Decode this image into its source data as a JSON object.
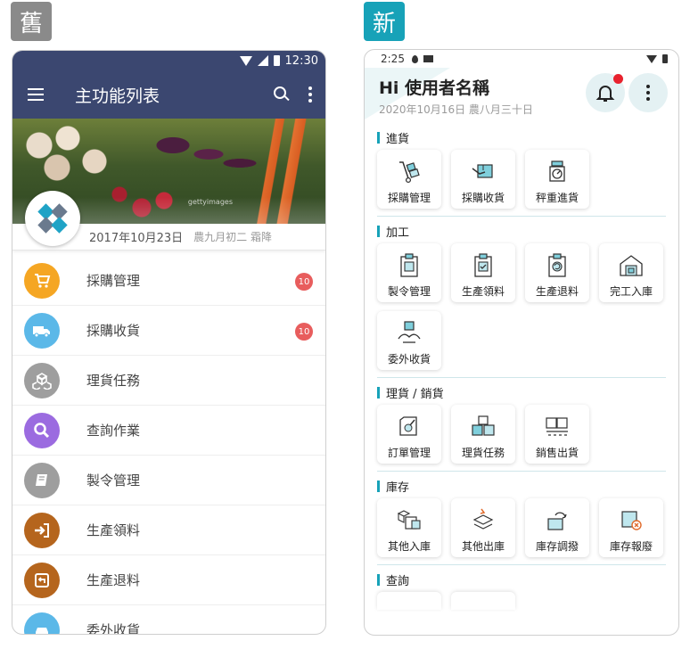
{
  "labels": {
    "old": "舊",
    "new": "新"
  },
  "old_app": {
    "status_time": "12:30",
    "title": "主功能列表",
    "banner_watermark": "gettyimages",
    "date": "2017年10月23日",
    "lunar": "農九月初二 霜降",
    "items": [
      {
        "label": "採購管理",
        "color": "#f5a623",
        "icon": "cart-icon",
        "badge": "10"
      },
      {
        "label": "採購收貨",
        "color": "#5bb8e8",
        "icon": "truck-icon",
        "badge": "10"
      },
      {
        "label": "理貨任務",
        "color": "#9e9e9e",
        "icon": "boxes-icon",
        "badge": ""
      },
      {
        "label": "查詢作業",
        "color": "#9b6be0",
        "icon": "search-icon",
        "badge": ""
      },
      {
        "label": "製令管理",
        "color": "#9e9e9e",
        "icon": "book-icon",
        "badge": ""
      },
      {
        "label": "生產領料",
        "color": "#b5651d",
        "icon": "sign-in-icon",
        "badge": ""
      },
      {
        "label": "生產退料",
        "color": "#b5651d",
        "icon": "return-icon",
        "badge": ""
      },
      {
        "label": "委外收貨",
        "color": "#5bb8e8",
        "icon": "car-icon",
        "badge": ""
      }
    ]
  },
  "new_app": {
    "status_time": "2:25",
    "greeting": "Hi 使用者名稱",
    "date": "2020年10月16日 農八月三十日",
    "sections": [
      {
        "title": "進貨",
        "tiles": [
          {
            "label": "採購管理",
            "icon": "hand-truck-icon"
          },
          {
            "label": "採購收貨",
            "icon": "receive-box-icon"
          },
          {
            "label": "秤重進貨",
            "icon": "scale-icon"
          }
        ]
      },
      {
        "title": "加工",
        "tiles": [
          {
            "label": "製令管理",
            "icon": "clipboard-icon"
          },
          {
            "label": "生產領料",
            "icon": "clipboard-check-icon"
          },
          {
            "label": "生產退料",
            "icon": "clipboard-return-icon"
          },
          {
            "label": "完工入庫",
            "icon": "warehouse-icon"
          },
          {
            "label": "委外收貨",
            "icon": "handover-box-icon"
          }
        ]
      },
      {
        "title": "理貨 / 銷貨",
        "tiles": [
          {
            "label": "訂單管理",
            "icon": "order-doc-icon"
          },
          {
            "label": "理貨任務",
            "icon": "stacked-boxes-icon"
          },
          {
            "label": "銷售出貨",
            "icon": "shipping-icon"
          }
        ]
      },
      {
        "title": "庫存",
        "tiles": [
          {
            "label": "其他入庫",
            "icon": "boxes-in-icon"
          },
          {
            "label": "其他出庫",
            "icon": "box-out-icon"
          },
          {
            "label": "庫存調撥",
            "icon": "transfer-box-icon"
          },
          {
            "label": "庫存報廢",
            "icon": "scrap-box-icon"
          }
        ]
      },
      {
        "title": "查詢",
        "tiles": []
      }
    ]
  }
}
